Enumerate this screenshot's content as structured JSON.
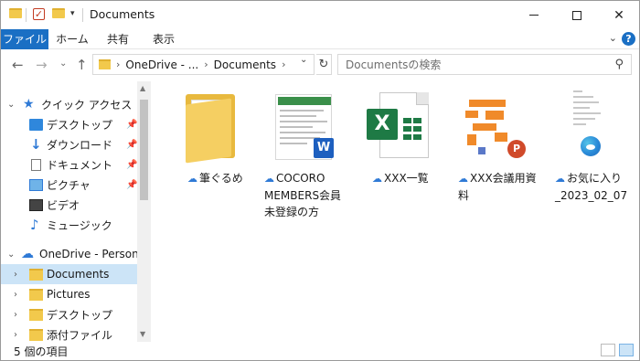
{
  "window": {
    "title": "Documents"
  },
  "ribbon": {
    "tabs": [
      "ファイル",
      "ホーム",
      "共有",
      "表示"
    ]
  },
  "address": {
    "crumbs": [
      "OneDrive - ...",
      "Documents"
    ],
    "search_placeholder": "Documentsの検索"
  },
  "nav": {
    "quick_access": "クイック アクセス",
    "items": [
      {
        "label": "デスクトップ",
        "icon": "desktop-icon",
        "pinned": true
      },
      {
        "label": "ダウンロード",
        "icon": "download-icon",
        "pinned": true
      },
      {
        "label": "ドキュメント",
        "icon": "document-icon",
        "pinned": true
      },
      {
        "label": "ピクチャ",
        "icon": "pictures-icon",
        "pinned": true
      },
      {
        "label": "ビデオ",
        "icon": "video-icon",
        "pinned": false
      },
      {
        "label": "ミュージック",
        "icon": "music-icon",
        "pinned": false
      }
    ],
    "onedrive": "OneDrive - Personal",
    "onedrive_items": [
      {
        "label": "Documents",
        "selected": true
      },
      {
        "label": "Pictures",
        "selected": false
      },
      {
        "label": "デスクトップ",
        "selected": false
      },
      {
        "label": "添付ファイル",
        "selected": false
      }
    ]
  },
  "files": [
    {
      "name": "筆ぐるめ",
      "type": "folder-icon"
    },
    {
      "name": "COCORO\nMEMBERS会員\n未登録の方",
      "type": "word-document-icon"
    },
    {
      "name": "XXX一覧",
      "type": "excel-icon"
    },
    {
      "name": "XXX会議用資\n料",
      "type": "powerpoint-icon"
    },
    {
      "name": "お気に入り\n_2023_02_07",
      "type": "edge-html-icon"
    }
  ],
  "status": {
    "count_text": "5 個の項目"
  },
  "colors": {
    "accent": "#1a6fc4",
    "selection": "#cce4f7",
    "folder": "#f2c94c"
  }
}
